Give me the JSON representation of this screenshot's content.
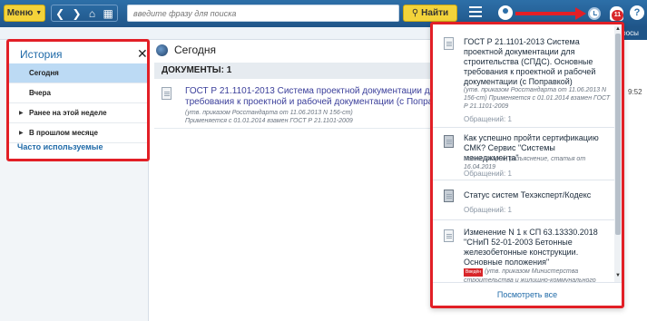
{
  "topbar": {
    "menu_label": "Меню",
    "search_placeholder": "введите фразу для поиска",
    "search_button": "Найти",
    "notification_count": "11",
    "help_label": "?"
  },
  "subbar": {
    "tab_label": "росы"
  },
  "history_panel": {
    "title": "История",
    "close": "✕",
    "items": [
      {
        "label": "Сегодня",
        "active": true
      },
      {
        "label": "Вчера",
        "active": false
      },
      {
        "label": "Ранее на этой неделе",
        "active": false
      },
      {
        "label": "В прошлом месяце",
        "active": false
      }
    ],
    "frequent": "Часто используемые"
  },
  "content": {
    "today_label": "Сегодня",
    "docs_header": "ДОКУМЕНТЫ: 1",
    "doc": {
      "title_line1": "ГОСТ Р 21.1101-2013 Система проектной документации для строите",
      "title_line2": "требования к проектной и рабочей документации (с Поправкой)",
      "meta_line1": "(утв. приказом Росстандарта от 11.06.2013 N 156-ст)",
      "meta_line2": "Применяется с 01.01.2014 взамен ГОСТ Р 21.1101-2009",
      "time": "9:52"
    }
  },
  "dropdown": {
    "items": [
      {
        "title": "ГОСТ Р 21.1101-2013 Система проектной документации для строительства (СПДС). Основные требования к проектной и рабочей документации (с Поправкой)",
        "meta": "(утв. приказом Росстандарта от 11.06.2013 N 156-ст) Применяется с 01.01.2014 взамен ГОСТ Р 21.1101-2009",
        "count": "Обращений: 1"
      },
      {
        "title": "Как успешно пройти сертификацию СМК? Сервис \"Системы менеджмента\"",
        "meta": "Комментарий, разъяснение, статья от 16.04.2019",
        "count": "Обращений: 1"
      },
      {
        "title": "Статус систем Техэксперт/Кодекс",
        "meta": "",
        "count": "Обращений: 1"
      },
      {
        "title": "Изменение N 1 к СП 63.13330.2018 \"СНиП 52-01-2003 Бетонные железобетонные конструкции. Основные положения\"",
        "tag": "Введён",
        "meta": "(утв. приказом Министерства строительства и жилищно-коммунального хозяйства Российской Федерации от 22.11.2019",
        "count": ""
      }
    ],
    "footer": "Посмотреть все"
  },
  "colors": {
    "accent_blue": "#2d6fa8",
    "annotation_red": "#e21f26",
    "button_yellow": "#f3d33a"
  }
}
